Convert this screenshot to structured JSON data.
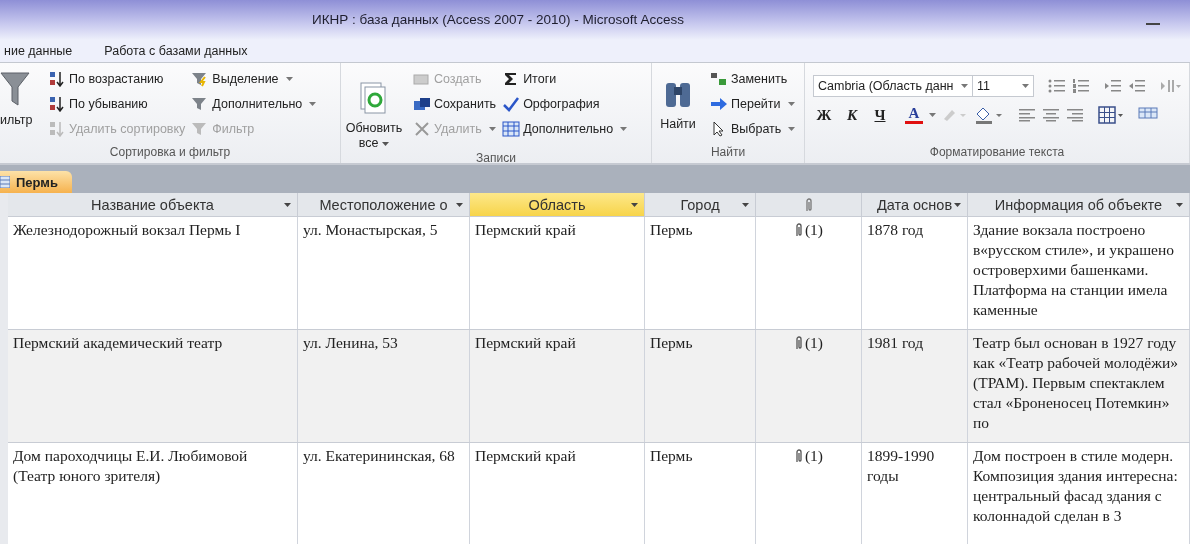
{
  "window": {
    "title": "ИКНР : база данных (Access 2007 - 2010)  -  Microsoft Access"
  },
  "ribbon_tabs": [
    {
      "label": "ние данные",
      "selected": false
    },
    {
      "label": "Работа с базами данных",
      "selected": false
    }
  ],
  "ribbon_groups": [
    {
      "label": "Сортировка и фильтр",
      "columns": [
        [
          {
            "kind": "large",
            "label": "ильтр",
            "disabled": false,
            "dropdown": false
          }
        ],
        [
          {
            "kind": "small",
            "label": "По возрастанию",
            "disabled": false,
            "dropdown": false
          },
          {
            "kind": "small",
            "label": "По убыванию",
            "disabled": false,
            "dropdown": false
          },
          {
            "kind": "small",
            "label": "Удалить сортировку",
            "disabled": true,
            "dropdown": false
          }
        ],
        [
          {
            "kind": "small",
            "label": "Выделение",
            "disabled": false,
            "dropdown": true
          },
          {
            "kind": "small",
            "label": "Дополнительно",
            "disabled": false,
            "dropdown": true
          },
          {
            "kind": "small",
            "label": "Фильтр",
            "disabled": true,
            "dropdown": false
          }
        ]
      ]
    },
    {
      "label": "Записи",
      "columns": [
        [
          {
            "kind": "large",
            "label": "Обновить все",
            "disabled": false,
            "dropdown": true
          }
        ],
        [
          {
            "kind": "small",
            "label": "Создать",
            "disabled": true,
            "dropdown": false
          },
          {
            "kind": "small",
            "label": "Сохранить",
            "disabled": false,
            "dropdown": false
          },
          {
            "kind": "small",
            "label": "Удалить",
            "disabled": true,
            "dropdown": true
          }
        ],
        [
          {
            "kind": "small",
            "label": "Итоги",
            "disabled": false,
            "dropdown": false
          },
          {
            "kind": "small",
            "label": "Орфография",
            "disabled": false,
            "dropdown": false
          },
          {
            "kind": "small",
            "label": "Дополнительно",
            "disabled": false,
            "dropdown": true
          }
        ]
      ]
    },
    {
      "label": "Найти",
      "columns": [
        [
          {
            "kind": "large",
            "label": "Найти",
            "disabled": false,
            "dropdown": false
          }
        ],
        [
          {
            "kind": "small",
            "label": "Заменить",
            "disabled": false,
            "dropdown": false
          },
          {
            "kind": "small",
            "label": "Перейти",
            "disabled": false,
            "dropdown": true
          },
          {
            "kind": "small",
            "label": "Выбрать",
            "disabled": false,
            "dropdown": true
          }
        ]
      ]
    }
  ],
  "text_formatting": {
    "label": "Форматирование текста",
    "font": "Cambria (Область данн",
    "size": "11",
    "bold": "Ж",
    "italic": "К",
    "underline": "Ч",
    "font_color": "A"
  },
  "document_tab": {
    "label": "Пермь",
    "selected": true
  },
  "table": {
    "columns": [
      {
        "kind": "text",
        "label": "Название объекта",
        "selected": false
      },
      {
        "kind": "text",
        "label": "Местоположение о",
        "selected": false
      },
      {
        "kind": "text",
        "label": "Область",
        "selected": true
      },
      {
        "kind": "text",
        "label": "Город",
        "selected": false
      },
      {
        "kind": "attachment",
        "selected": false
      },
      {
        "kind": "text",
        "label": "Дата основ",
        "selected": false
      },
      {
        "kind": "text",
        "label": "Информация об объекте",
        "selected": false
      }
    ],
    "rows": [
      {
        "cells": [
          "Железнодорожный вокзал Пермь  I",
          "ул. Монастырская, 5",
          "Пермский край",
          "Пермь",
          "(1)",
          "1878 год",
          "Здание вокзала построено в«русском стиле», и украшено островерхими башенками. Платформа на станции имела каменные"
        ]
      },
      {
        "cells": [
          "Пермский академический театр",
          " ул. Ленина, 53",
          "Пермский край",
          "Пермь",
          "(1)",
          "1981 год",
          "Театр был основан в 1927 году как «Театр рабочей молодёжи» (ТРАМ). Первым спектаклем стал «Броненосец Потемкин» по"
        ]
      },
      {
        "cells": [
          "Дом пароходчицы Е.И. Любимовой (Театр юного зрителя)",
          "ул. Екатерининская, 68",
          "Пермский край",
          "Пермь",
          "(1)",
          "1899-1990 годы",
          "Дом построен в стиле модерн. Композиция здания интересна: центральный фасад здания с колоннадой сделан в 3"
        ]
      }
    ]
  }
}
